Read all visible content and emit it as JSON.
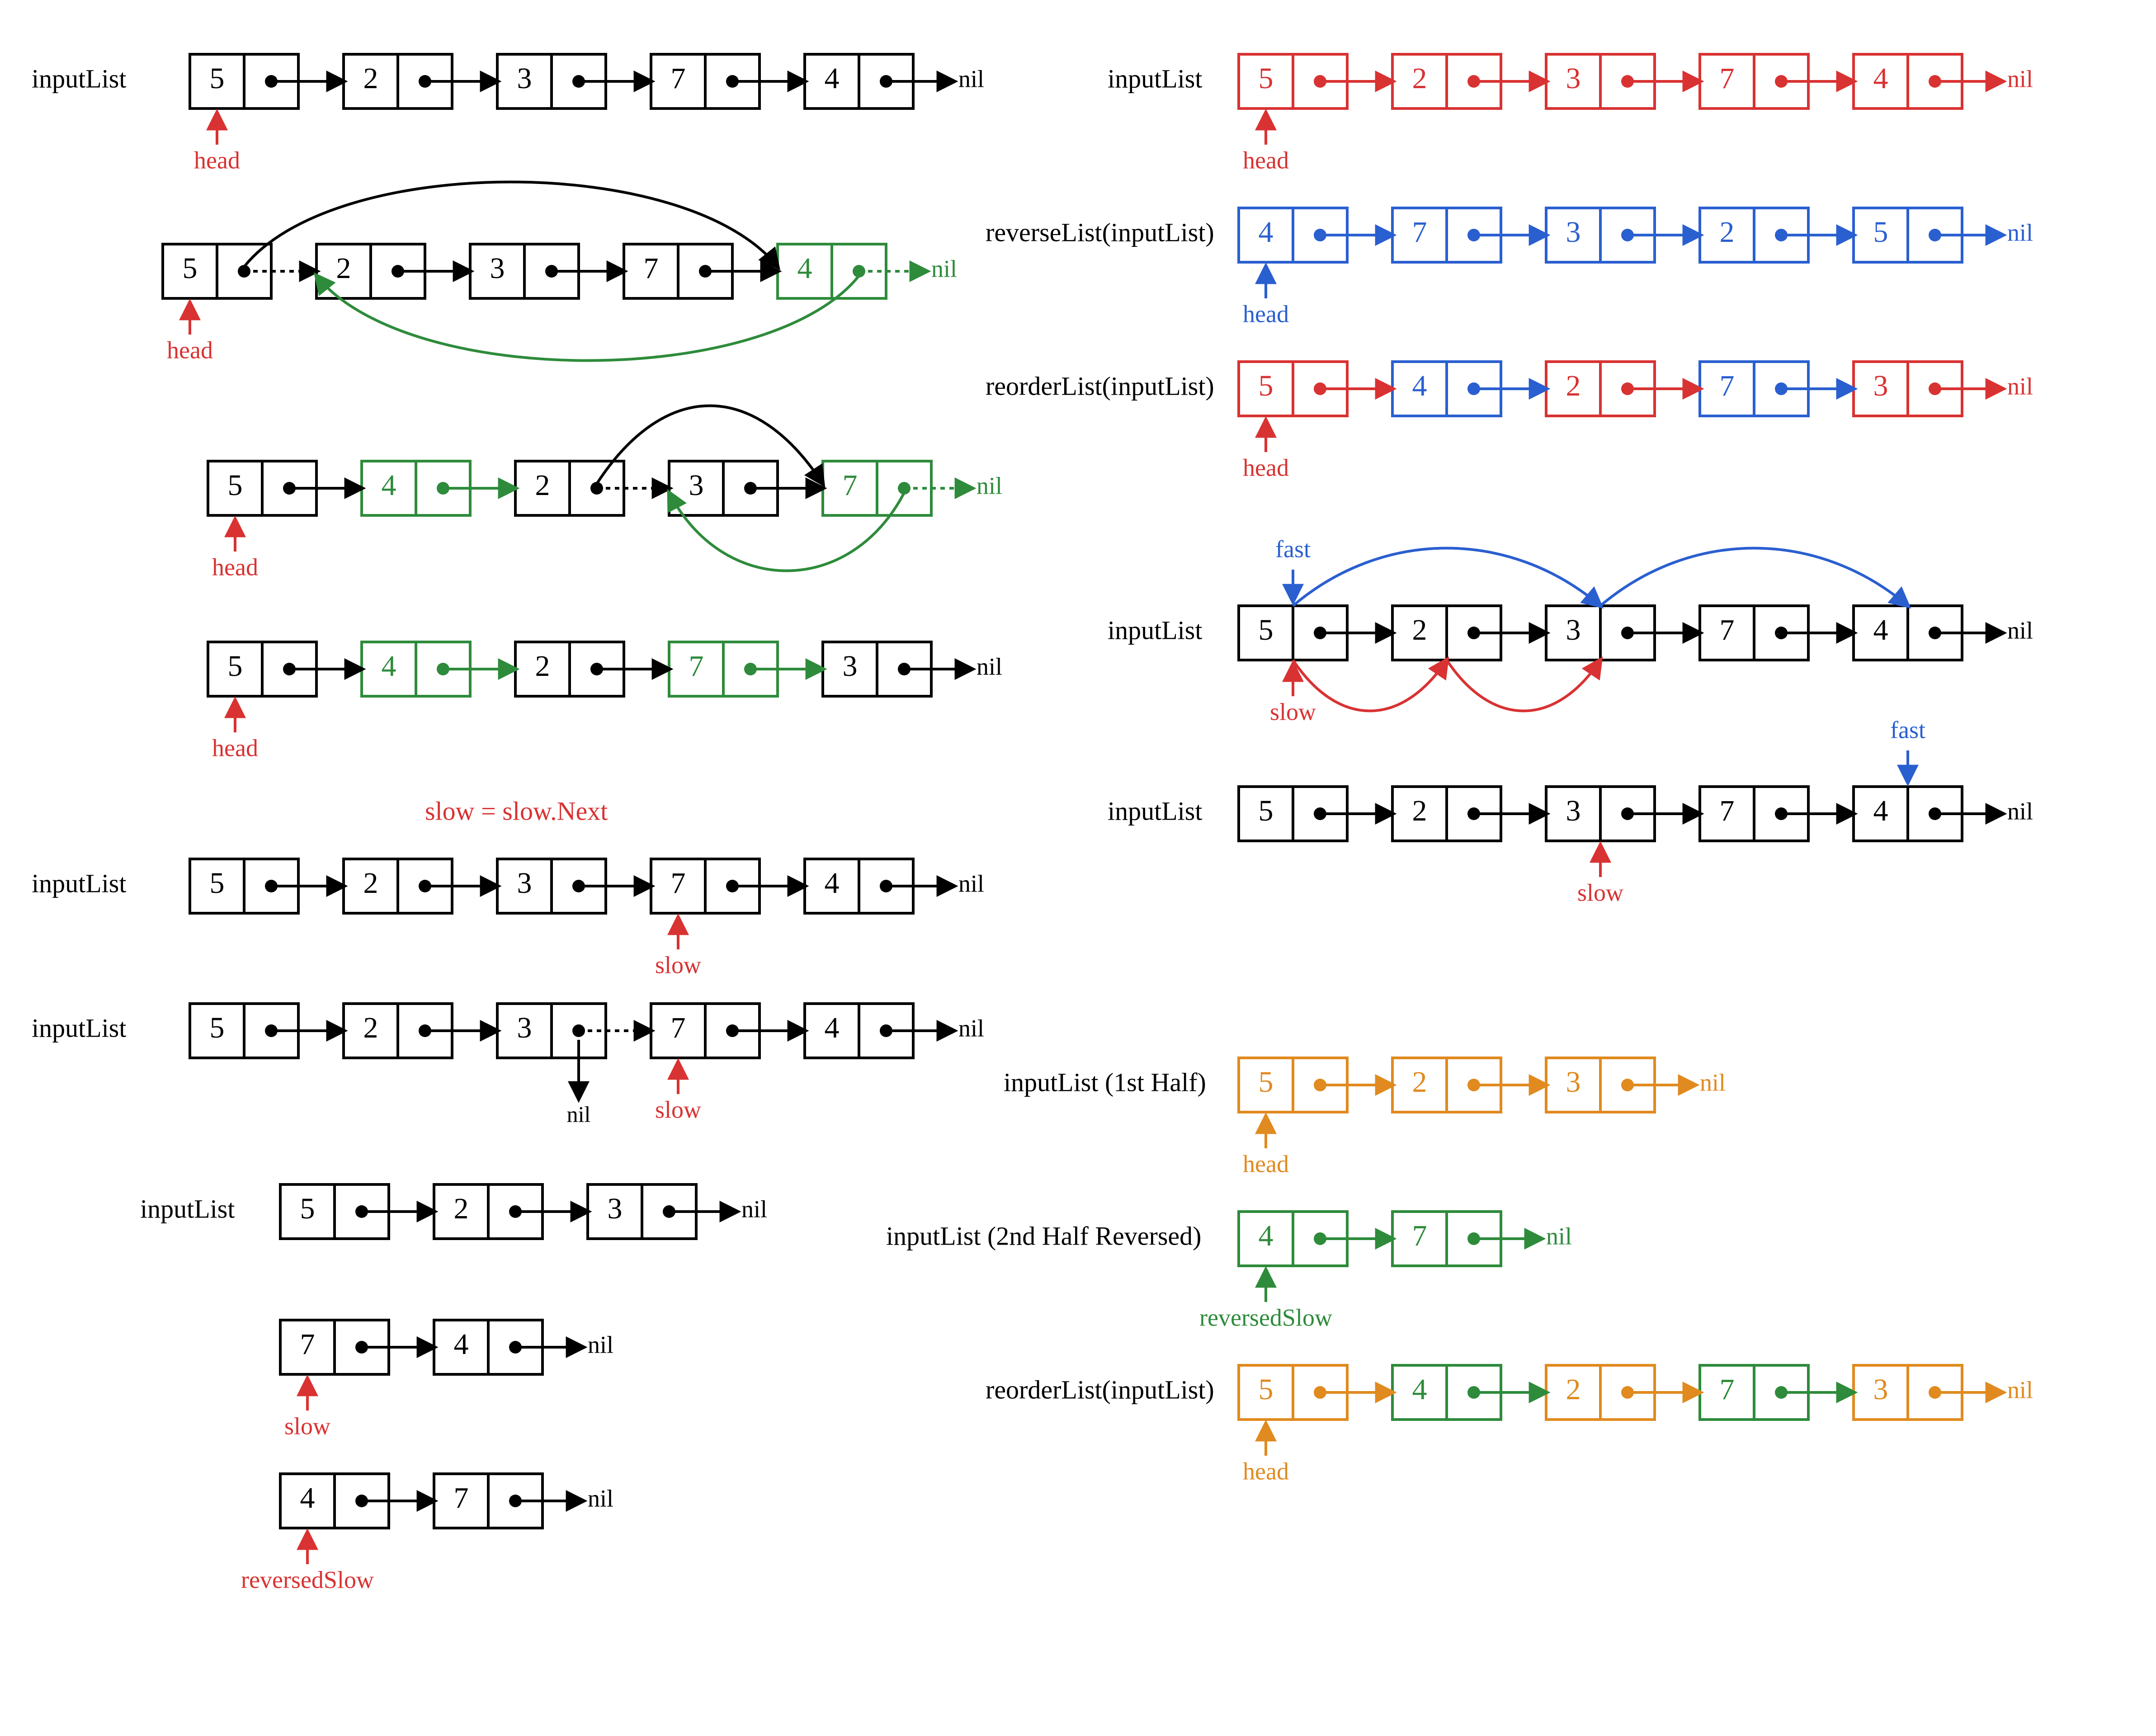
{
  "colors": {
    "black": "#000",
    "red": "#d93232",
    "green": "#2e8b3b",
    "blue": "#2a5fd0",
    "orange": "#e08a1f"
  },
  "labels": {
    "inputList": "inputList",
    "nil": "nil",
    "head": "head",
    "slow": "slow",
    "fast": "fast",
    "reversedSlow": "reversedSlow",
    "slowEqNext": "slow = slow.Next",
    "reverseList": "reverseList(inputList)",
    "reorderList": "reorderList(inputList)",
    "inputList1stHalf": "inputList (1st Half)",
    "inputList2ndHalfRev": "inputList (2nd Half Reversed)"
  },
  "values": {
    "base": [
      "5",
      "2",
      "3",
      "7",
      "4"
    ],
    "reversed": [
      "4",
      "7",
      "3",
      "2",
      "5"
    ],
    "reorder": [
      "5",
      "4",
      "2",
      "7",
      "3"
    ],
    "half1": [
      "5",
      "2",
      "3"
    ],
    "slowHalf": [
      "7",
      "4"
    ],
    "revSlow": [
      "4",
      "7"
    ]
  }
}
